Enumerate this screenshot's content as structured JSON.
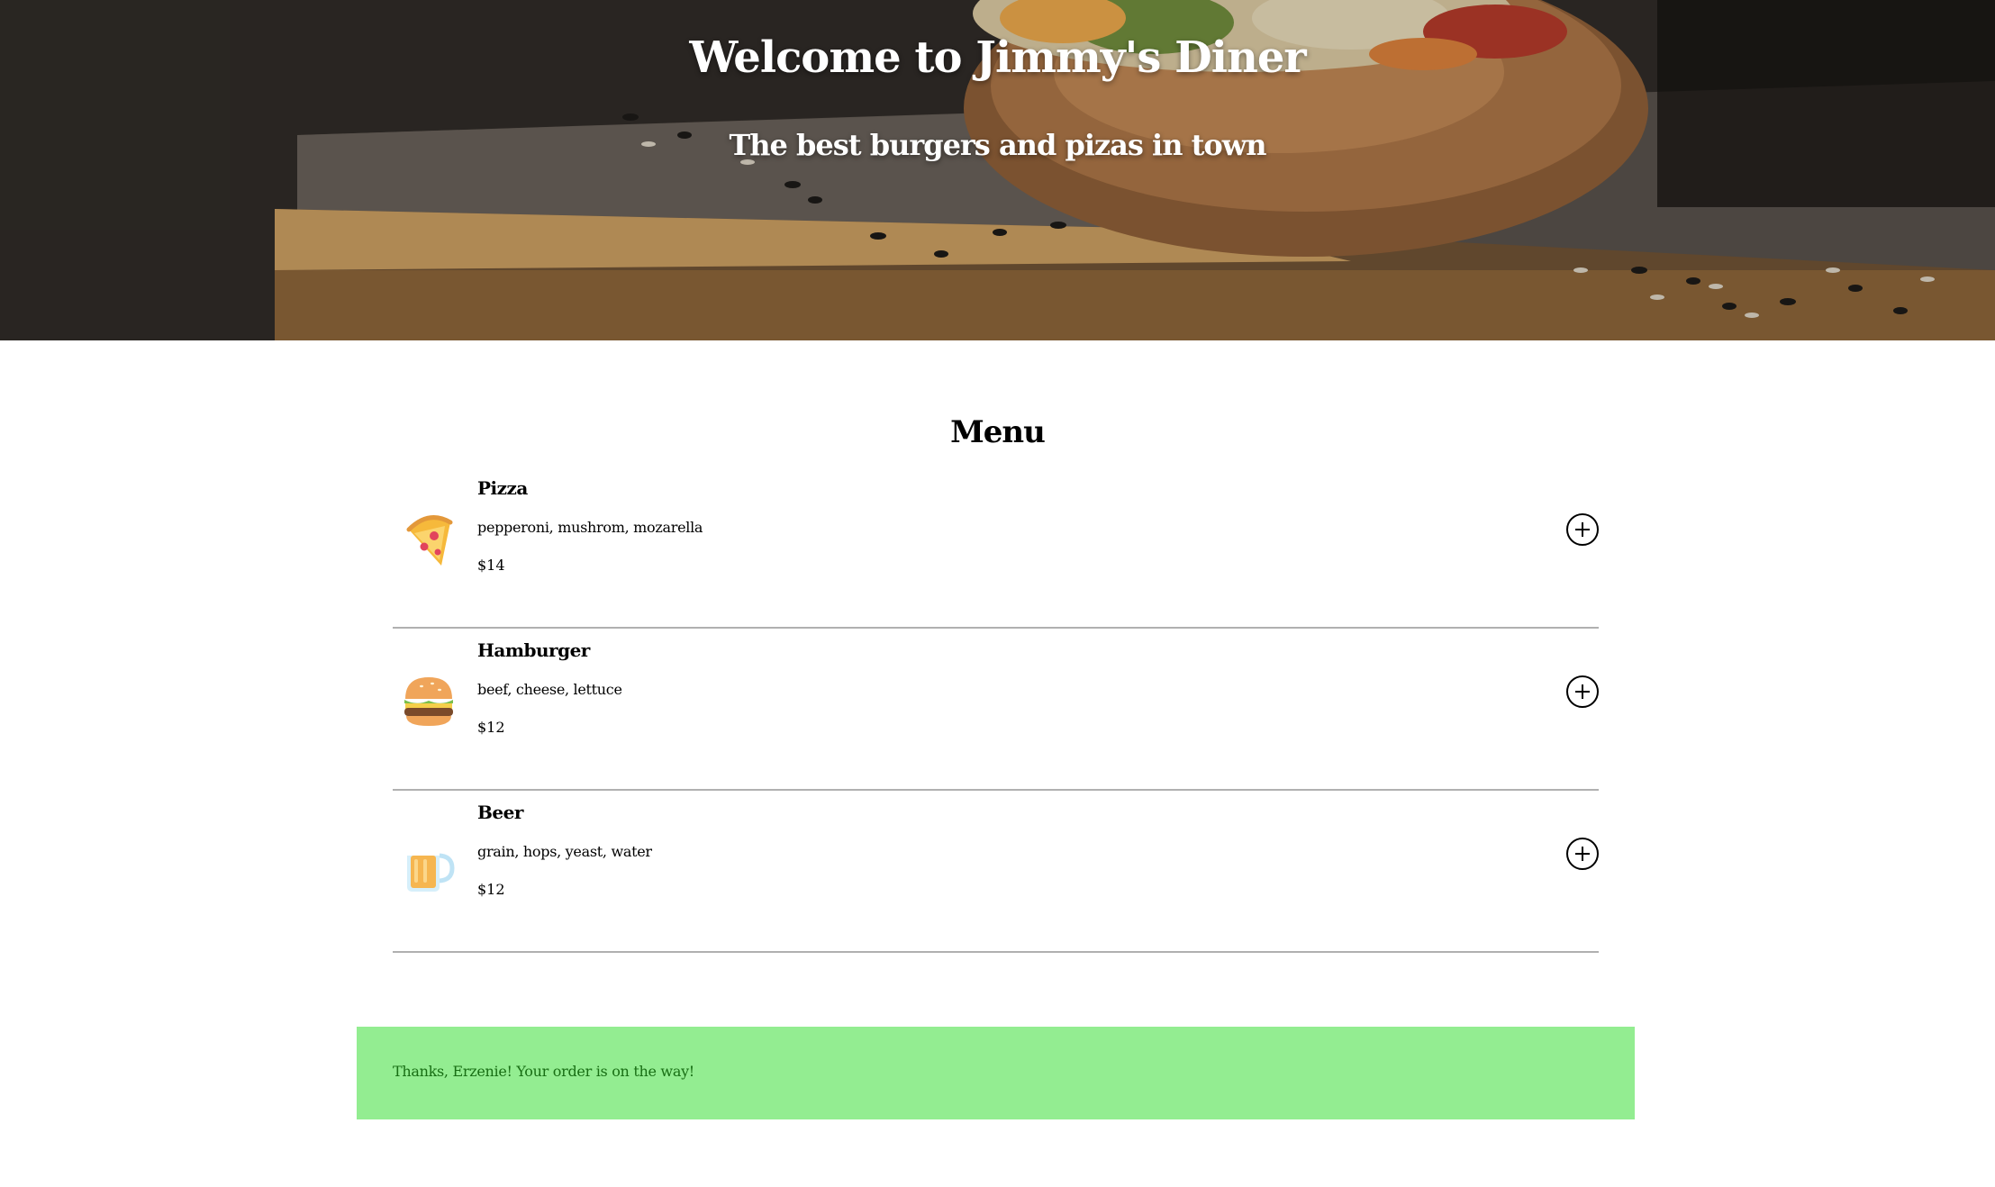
{
  "header": {
    "title": "Welcome to Jimmy's Diner",
    "subtitle": "The best burgers and pizas in town"
  },
  "menu": {
    "title": "Menu",
    "add_icon": "plus-circle-icon",
    "items": [
      {
        "name": "Pizza",
        "ingredients": "pepperoni, mushrom, mozarella",
        "price": "$14",
        "icon": "pizza-icon"
      },
      {
        "name": "Hamburger",
        "ingredients": "beef, cheese, lettuce",
        "price": "$12",
        "icon": "hamburger-icon"
      },
      {
        "name": "Beer",
        "ingredients": "grain, hops, yeast, water",
        "price": "$12",
        "icon": "beer-icon"
      }
    ]
  },
  "order": {
    "message": "Thanks, Erzenie! Your order is on the way!",
    "background_color": "#93ed91",
    "text_color": "#186e14"
  }
}
